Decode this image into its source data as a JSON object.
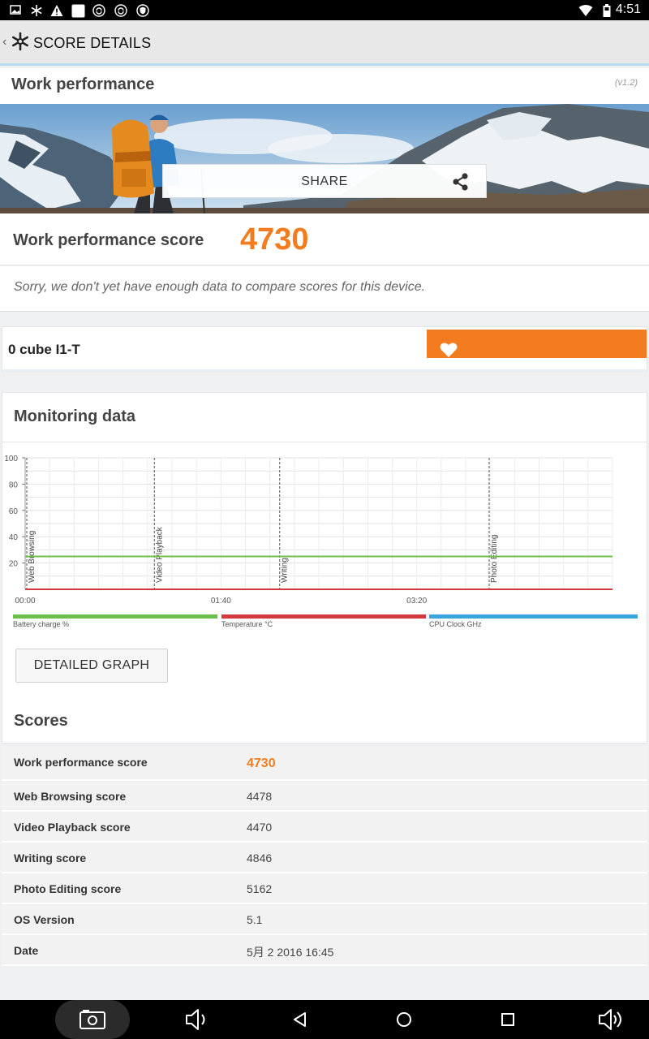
{
  "status_bar": {
    "time": "4:51",
    "left_icons": [
      "image-icon",
      "snowflake-icon",
      "warning-icon",
      "square-icon",
      "sync-icon",
      "sync-icon",
      "shield-icon"
    ],
    "right_icons": [
      "wifi-icon",
      "battery-icon"
    ]
  },
  "action_bar": {
    "title": "SCORE DETAILS"
  },
  "benchmark": {
    "title": "Work performance",
    "version": "(v1.2)"
  },
  "share": {
    "label": "SHARE"
  },
  "score": {
    "label": "Work performance score",
    "value": "4730",
    "compare_message": "Sorry, we don't yet have enough data to compare scores for this device."
  },
  "device": {
    "name": "0 cube I1-T",
    "bar_fraction": 0.34
  },
  "monitoring": {
    "title": "Monitoring data",
    "detailed_button": "DETAILED GRAPH",
    "legend": [
      {
        "label": "Battery charge %",
        "color": "#6cc04a"
      },
      {
        "label": "Temperature °C",
        "color": "#d3373f"
      },
      {
        "label": "CPU Clock GHz",
        "color": "#3aa6dd"
      }
    ]
  },
  "chart_data": {
    "type": "line",
    "x_ticks": [
      "00:00",
      "01:40",
      "03:20"
    ],
    "x_range_seconds": [
      0,
      300
    ],
    "y_ticks": [
      20,
      40,
      60,
      80,
      100
    ],
    "ylim": [
      0,
      100
    ],
    "grid": true,
    "series": [
      {
        "name": "Battery charge %",
        "x": [
          0,
          300
        ],
        "y": [
          25,
          25
        ],
        "color": "#6cc04a"
      },
      {
        "name": "Temperature °C",
        "x": [
          0,
          300
        ],
        "y": [
          0,
          0
        ],
        "color": "#d3373f"
      }
    ],
    "markers": [
      {
        "label": "Web Browsing",
        "x": 0
      },
      {
        "label": "Video Playback",
        "x": 66
      },
      {
        "label": "Writing",
        "x": 130
      },
      {
        "label": "Photo Editing",
        "x": 237
      }
    ]
  },
  "scores": {
    "title": "Scores",
    "rows": [
      {
        "label": "Work performance score",
        "value": "4730"
      },
      {
        "label": "Web Browsing score",
        "value": "4478"
      },
      {
        "label": "Video Playback score",
        "value": "4470"
      },
      {
        "label": "Writing score",
        "value": "4846"
      },
      {
        "label": "Photo Editing score",
        "value": "5162"
      },
      {
        "label": "OS Version",
        "value": "5.1"
      },
      {
        "label": "Date",
        "value": "5月 2 2016 16:45"
      }
    ]
  },
  "nav_bar": {
    "icons": [
      "screenshot-icon",
      "volume-down-icon",
      "back-icon",
      "home-icon",
      "recents-icon",
      "volume-up-icon"
    ]
  }
}
